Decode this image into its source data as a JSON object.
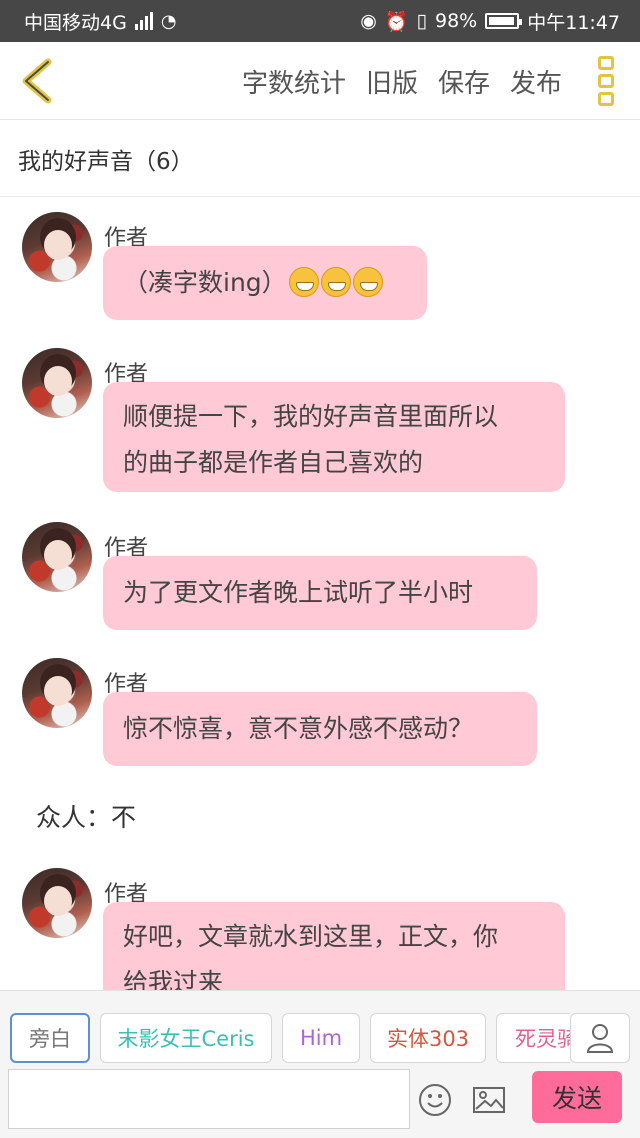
{
  "status_bar": {
    "carrier": "中国移动4G",
    "network_badge": "4G",
    "battery": "98%",
    "time": "中午11:47"
  },
  "top_bar": {
    "actions": [
      "字数统计",
      "旧版",
      "保存",
      "发布"
    ]
  },
  "story": {
    "title": "我的好声音（6）"
  },
  "messages": [
    {
      "type": "dialog",
      "speaker": "作者",
      "text": "（凑字数ing）",
      "emoji_count": 3
    },
    {
      "type": "dialog",
      "speaker": "作者",
      "lines": [
        "顺便提一下，我的好声音里面所以",
        "的曲子都是作者自己喜欢的"
      ]
    },
    {
      "type": "dialog",
      "speaker": "作者",
      "text": "为了更文作者晚上试听了半小时"
    },
    {
      "type": "dialog",
      "speaker": "作者",
      "text": "惊不惊喜，意不意外感不感动？"
    },
    {
      "type": "narration",
      "text": "众人：不"
    },
    {
      "type": "dialog",
      "speaker": "作者",
      "lines": [
        "好吧，文章就水到这里，正文，你",
        "给我过来"
      ]
    }
  ],
  "composer": {
    "roles": [
      "旁白",
      "末影女王Ceris",
      "Him",
      "实体303",
      "死灵骑"
    ],
    "role_colors": [
      "#777777",
      "#3bbfb4",
      "#b065d6",
      "#d9553f",
      "#e0618a"
    ],
    "active_role": "旁白",
    "input_value": "",
    "send_label": "发送"
  }
}
